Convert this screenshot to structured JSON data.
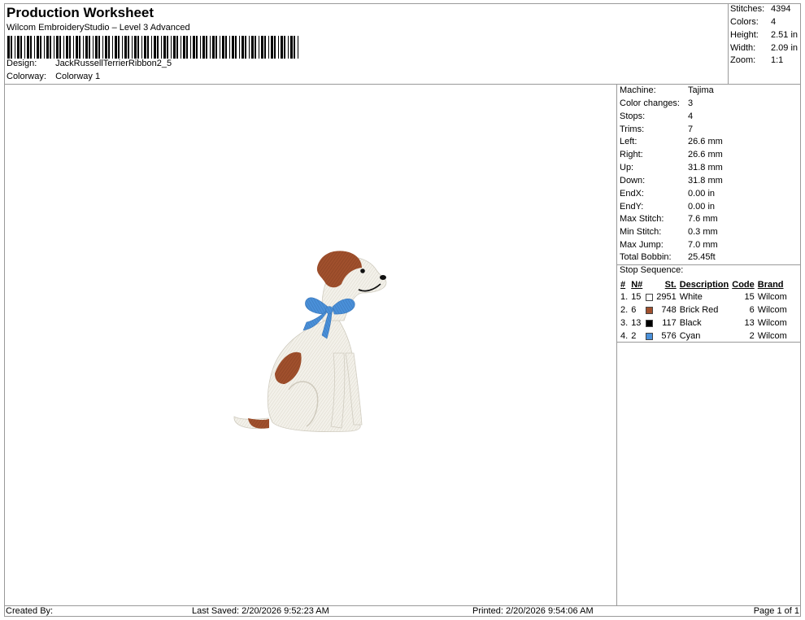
{
  "header": {
    "title": "Production Worksheet",
    "subtitle": "Wilcom EmbroideryStudio – Level 3 Advanced",
    "design_label": "Design:",
    "design_value": "JackRussellTerrierRibbon2_5",
    "colorway_label": "Colorway:",
    "colorway_value": "Colorway 1"
  },
  "summary": {
    "stitches_label": "Stitches:",
    "stitches": "4394",
    "colors_label": "Colors:",
    "colors": "4",
    "height_label": "Height:",
    "height": "2.51 in",
    "width_label": "Width:",
    "width": "2.09 in",
    "zoom_label": "Zoom:",
    "zoom": "1:1"
  },
  "specs": {
    "machine_label": "Machine:",
    "machine": "Tajima",
    "color_changes_label": "Color changes:",
    "color_changes": "3",
    "stops_label": "Stops:",
    "stops": "4",
    "trims_label": "Trims:",
    "trims": "7",
    "left_label": "Left:",
    "left": "26.6 mm",
    "right_label": "Right:",
    "right": "26.6 mm",
    "up_label": "Up:",
    "up": "31.8 mm",
    "down_label": "Down:",
    "down": "31.8 mm",
    "endx_label": "EndX:",
    "endx": "0.00 in",
    "endy_label": "EndY:",
    "endy": "0.00 in",
    "max_stitch_label": "Max Stitch:",
    "max_stitch": "7.6 mm",
    "min_stitch_label": "Min Stitch:",
    "min_stitch": "0.3 mm",
    "max_jump_label": "Max Jump:",
    "max_jump": "7.0 mm",
    "total_bobbin_label": "Total Bobbin:",
    "total_bobbin": "25.45ft"
  },
  "stop_sequence": {
    "heading": "Stop Sequence:",
    "columns": [
      "#",
      "N#",
      "St.",
      "Description",
      "Code",
      "Brand"
    ],
    "rows": [
      {
        "idx": "1.",
        "n": "15",
        "color": "#ffffff",
        "st": "2951",
        "desc": "White",
        "code": "15",
        "brand": "Wilcom"
      },
      {
        "idx": "2.",
        "n": "6",
        "color": "#a0502d",
        "st": "748",
        "desc": "Brick Red",
        "code": "6",
        "brand": "Wilcom"
      },
      {
        "idx": "3.",
        "n": "13",
        "color": "#000000",
        "st": "117",
        "desc": "Black",
        "code": "13",
        "brand": "Wilcom"
      },
      {
        "idx": "4.",
        "n": "2",
        "color": "#4a90d9",
        "st": "576",
        "desc": "Cyan",
        "code": "2",
        "brand": "Wilcom"
      }
    ]
  },
  "footer": {
    "created_by": "Created By:",
    "last_saved": "Last Saved: 2/20/2026 9:52:23 AM",
    "printed": "Printed: 2/20/2026 9:54:06 AM",
    "page": "Page 1 of 1"
  },
  "colors": {
    "border": "#9a9a9a",
    "fabric_white": "#f3f1ea",
    "brick_red": "#a0502d",
    "cyan": "#4a90d9"
  }
}
